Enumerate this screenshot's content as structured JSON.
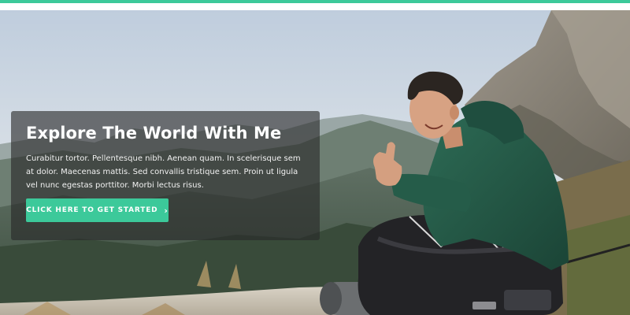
{
  "hero": {
    "title": "Explore The World With Me",
    "body": "Curabitur tortor. Pellentesque nibh. Aenean quam. In scelerisque sem at dolor. Maecenas mattis. Sed convallis tristique sem. Proin ut ligula vel nunc egestas porttitor. Morbi lectus risus.",
    "cta_label": "CLICK HERE TO GET STARTED",
    "cta_icon": "chevron-right-icon",
    "background_image": "hiker-with-backpack-on-mountain-photo"
  },
  "colors": {
    "accent": "#3cc99a",
    "overlay": "#282828"
  }
}
